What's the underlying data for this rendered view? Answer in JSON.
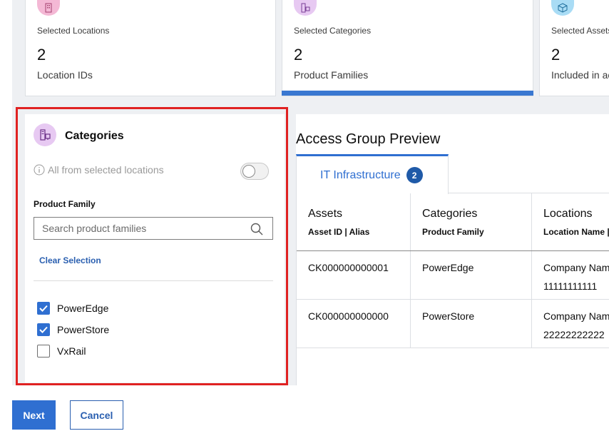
{
  "summary_cards": [
    {
      "label": "Selected Locations",
      "value": "2",
      "sub": "Location IDs",
      "icon": "building-icon",
      "color": "#f4b8d5",
      "active": false
    },
    {
      "label": "Selected Categories",
      "value": "2",
      "sub": "Product Families",
      "icon": "server-icon",
      "color": "#e7c9f2",
      "active": true
    },
    {
      "label": "Selected Assets",
      "value": "2",
      "sub": "Included in access group",
      "icon": "cube-icon",
      "color": "#a9dcf5",
      "active": false
    }
  ],
  "categories_panel": {
    "title": "Categories",
    "all_from_label": "All from selected locations",
    "toggle_on": false,
    "product_family_label": "Product Family",
    "search_placeholder": "Search product families",
    "search_value": "",
    "clear_selection": "Clear Selection",
    "options": [
      {
        "label": "PowerEdge",
        "checked": true
      },
      {
        "label": "PowerStore",
        "checked": true
      },
      {
        "label": "VxRail",
        "checked": false
      }
    ]
  },
  "preview": {
    "title": "Access Group Preview",
    "tab_label": "IT Infrastructure",
    "tab_count": "2",
    "columns": [
      {
        "title": "Assets",
        "subtitle": "Asset ID | Alias"
      },
      {
        "title": "Categories",
        "subtitle": "Product Family"
      },
      {
        "title": "Locations",
        "subtitle": "Location Name | ID"
      }
    ],
    "rows": [
      {
        "asset": "CK000000000001",
        "category": "PowerEdge",
        "location_name": "Company Name",
        "location_id": "11111111111"
      },
      {
        "asset": "CK000000000000",
        "category": "PowerStore",
        "location_name": "Company Name",
        "location_id": "22222222222"
      }
    ]
  },
  "footer": {
    "next_label": "Next",
    "cancel_label": "Cancel"
  },
  "colors": {
    "accent": "#2f6fd1",
    "highlight_border": "#e02222"
  }
}
